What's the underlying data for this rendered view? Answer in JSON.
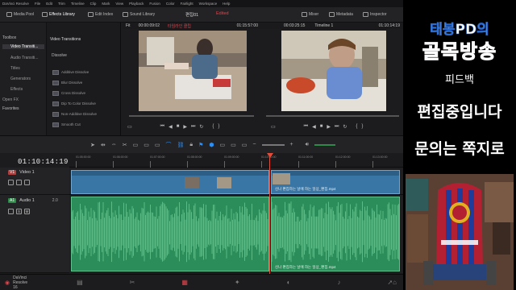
{
  "menubar": {
    "items": [
      "DaVinci Resolve",
      "File",
      "Edit",
      "Trim",
      "Timeline",
      "Clip",
      "Mark",
      "View",
      "Playback",
      "Fusion",
      "Color",
      "Fairlight",
      "Workspace",
      "Help"
    ]
  },
  "toolbar": {
    "media_pool": "Media Pool",
    "effects_library": "Effects Library",
    "edit_index": "Edit Index",
    "sound_library": "Sound Library",
    "project_title": "편집01",
    "project_status": "Edited",
    "mixer": "Mixer",
    "metadata": "Metadata",
    "inspector": "Inspector"
  },
  "left_panel": {
    "header": "Toolbox",
    "items": [
      "Video Transiti...",
      "Audio Transiti...",
      "Titles",
      "Generators",
      "Effects",
      "Open FX"
    ],
    "selected_index": 0,
    "favorites": "Favorites"
  },
  "effects_panel": {
    "header": "Video Transitions",
    "section": "Dissolve",
    "items": [
      "Additive Dissolve",
      "Blur Dissolve",
      "Cross Dissolve",
      "Dip To Color Dissolve",
      "Non-Additive Dissolve",
      "Smooth Cut"
    ]
  },
  "source_viewer": {
    "fit": "Fit",
    "timecode": "00:00:09:02",
    "clip_name": "타임라인 클립",
    "duration": "01:15:57:00"
  },
  "timeline_viewer": {
    "timecode": "00:03:25:15",
    "timeline_name": "Timeline 1",
    "current_tc": "01:10:14:19"
  },
  "timeline": {
    "timecode": "01:10:14:19",
    "ruler_labels": [
      "01:05:00:00",
      "01:06:00:00",
      "01:07:00:00",
      "01:08:00:00",
      "01:09:00:00",
      "01:10:00:00",
      "01:11:00:00",
      "01:12:00:00",
      "01:13:00:00"
    ],
    "video_track": {
      "badge": "V1",
      "name": "Video 1"
    },
    "audio_track": {
      "badge": "A1",
      "name": "Audio 1",
      "level": "2.0"
    },
    "clip_label_video": "신나 편집하는 날에 하는 일상_편집.mp4",
    "clip_label_audio": "신나 편집하는 날에 하는 일상_편집.mp4"
  },
  "bottombar": {
    "app_name": "DaVinci Resolve 16"
  },
  "sidebar": {
    "channel_line1": "태봉PD의",
    "channel_line2": "골목방송",
    "feedback": "피드백",
    "msg1": "편집중입니다",
    "msg2": "문의는 쪽지로"
  },
  "colors": {
    "accent_red": "#e24c3a",
    "video_clip": "#3976a5",
    "audio_clip": "#2a8d5a",
    "brand_blue": "#2a6bd1"
  }
}
